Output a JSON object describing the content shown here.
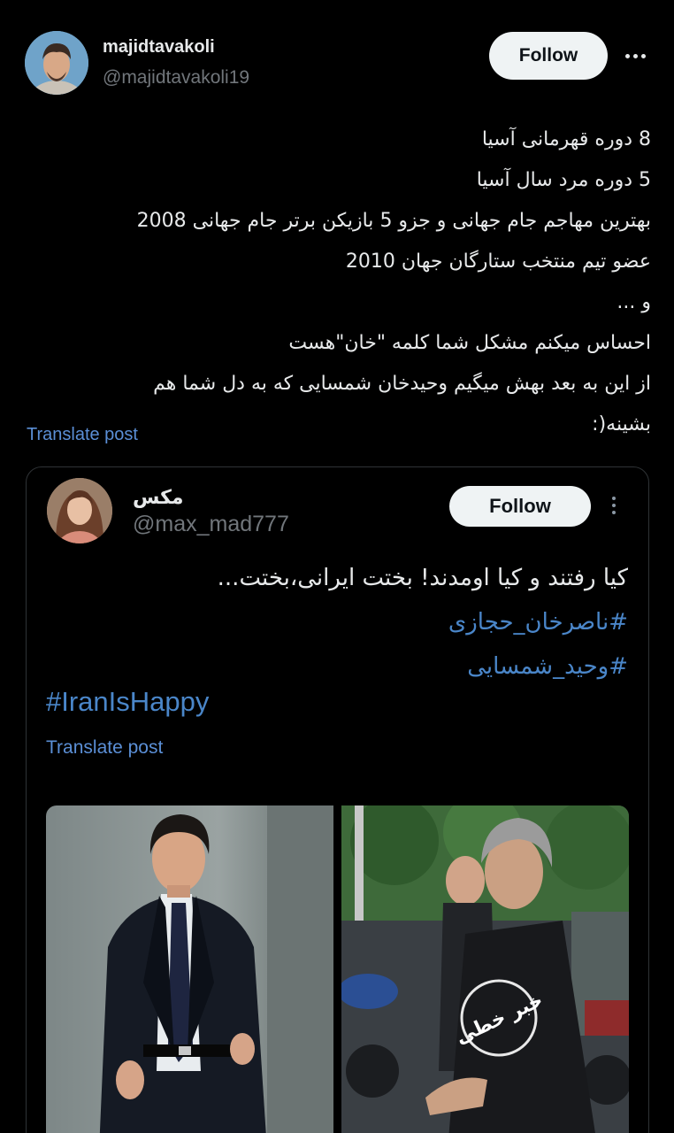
{
  "post": {
    "username": "majidtavakoli",
    "handle": "@majidtavakoli19",
    "follow_label": "Follow",
    "lines": [
      "8 دوره قهرمانی آسیا",
      "5 دوره مرد سال آسیا",
      "بهترین مهاجم جام جهانی و جزو 5 بازیکن برتر جام جهانی 2008",
      "عضو تیم منتخب ستارگان جهان 2010",
      "و ...",
      "احساس میکنم مشکل شما کلمه \"خان\"هست",
      "از این به بعد بهش میگیم وحیدخان شمسایی که به دل شما هم",
      "بشینه(:"
    ],
    "translate_label": "Translate post"
  },
  "quote": {
    "name": "مکس",
    "handle": "@max_mad777",
    "follow_label": "Follow",
    "text": "کیا رفتند و کیا اومدند! بختت ایرانی،بختت...",
    "hashtags": [
      "#ناصرخان_حجازی",
      "#وحید_شمسایی"
    ],
    "hashtag_en": "#IranIsHappy",
    "translate_label": "Translate post",
    "watermark": "خبر خطی"
  }
}
